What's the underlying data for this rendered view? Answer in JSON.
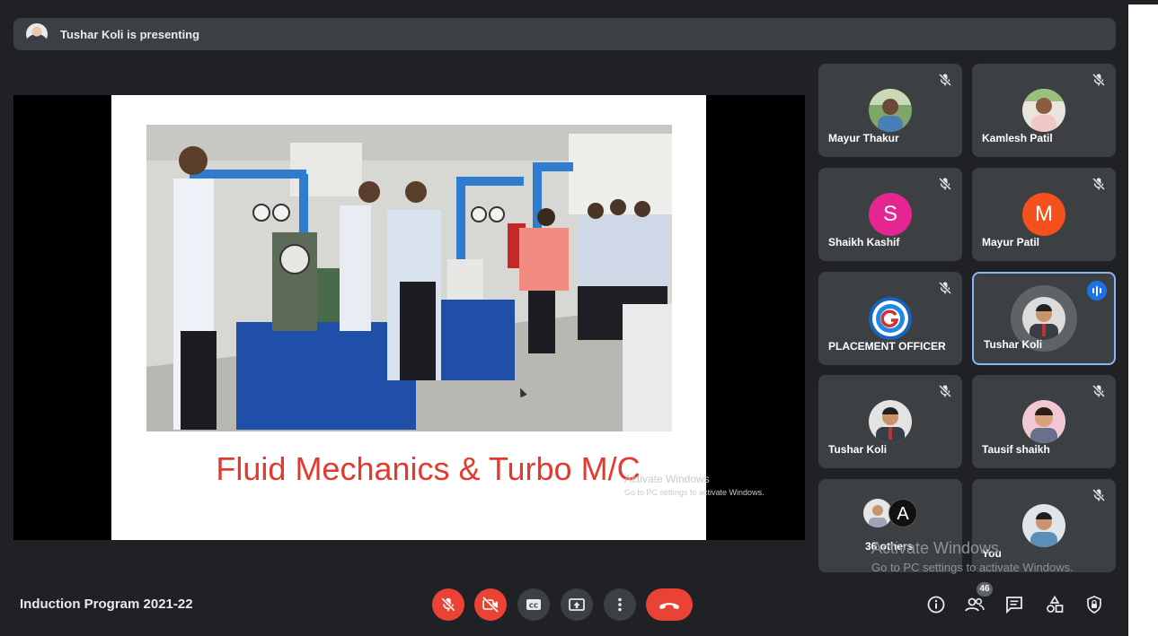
{
  "banner": {
    "presenting_text": "Tushar Koli is presenting"
  },
  "slide": {
    "caption": "Fluid Mechanics & Turbo M/C"
  },
  "participants": [
    {
      "name": "Mayur Thakur",
      "muted": true
    },
    {
      "name": "Kamlesh Patil",
      "muted": true
    },
    {
      "name": "Shaikh Kashif",
      "initial": "S",
      "color": "#e52592",
      "muted": true
    },
    {
      "name": "Mayur Patil",
      "initial": "M",
      "color": "#f4511e",
      "muted": true
    },
    {
      "name": "PLACEMENT OFFICER",
      "muted": true
    },
    {
      "name": "Tushar Koli",
      "speaking": true
    },
    {
      "name": "Tushar Koli",
      "muted": true
    },
    {
      "name": "Tausif shaikh",
      "muted": true
    },
    {
      "name": "36 others",
      "initial": "A"
    },
    {
      "name": "You",
      "muted": true
    }
  ],
  "activation": {
    "title": "Activate Windows",
    "subtitle": "Go to PC settings to activate Windows."
  },
  "activation_small": {
    "title": "Activate Windows",
    "subtitle": "Go to PC settings to activate Windows."
  },
  "footer": {
    "meeting_title": "Induction Program 2021-22",
    "people_count": "46"
  },
  "colors": {
    "background": "#202124",
    "tile": "#3c4043",
    "danger": "#ea4335",
    "active_border": "#8ab4f8",
    "accent": "#1a73e8"
  }
}
